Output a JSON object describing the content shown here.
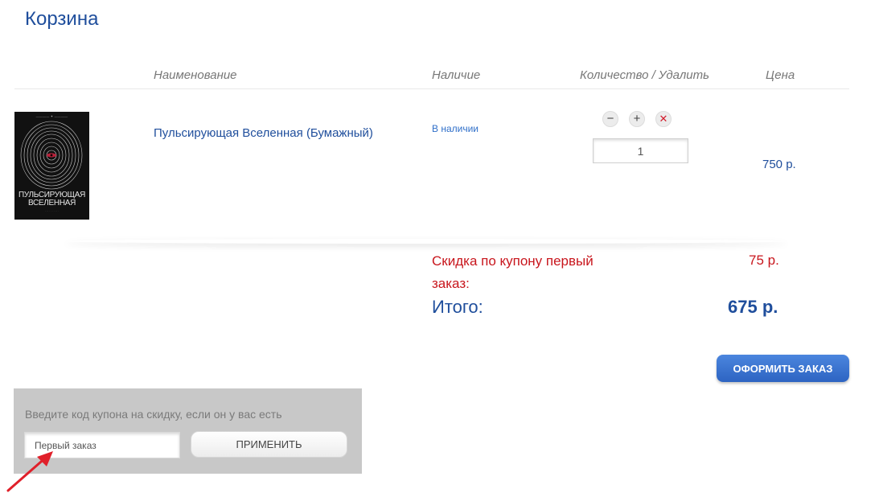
{
  "page": {
    "title": "Корзина"
  },
  "table": {
    "headers": {
      "name": "Наименование",
      "stock": "Наличие",
      "qty": "Количество / Удалить",
      "price": "Цена"
    }
  },
  "cart": {
    "items": [
      {
        "name": "Пульсирующая Вселенная (Бумажный)",
        "stock": "В наличии",
        "quantity": "1",
        "price": "750 р.",
        "cover": {
          "title_line1": "ПУЛЬСИРУЮЩАЯ",
          "title_line2": "ВСЕЛЕННАЯ"
        }
      }
    ],
    "controls": {
      "minus_icon": "minus-icon",
      "plus_icon": "plus-icon",
      "delete_icon": "close-icon"
    }
  },
  "summary": {
    "discount_label": "Скидка по купону первый заказ:",
    "discount_value": "75 р.",
    "total_label": "Итого:",
    "total_value": "675 р."
  },
  "checkout": {
    "label": "ОФОРМИТЬ ЗАКАЗ"
  },
  "coupon": {
    "hint": "Введите код купона на скидку, если он у вас есть",
    "value": "Первый заказ",
    "apply_label": "ПРИМЕНИТЬ"
  },
  "colors": {
    "accent": "#1f4e9c",
    "discount": "#c8161d",
    "button": "#2d64c2",
    "annotation": "#e0202a"
  }
}
